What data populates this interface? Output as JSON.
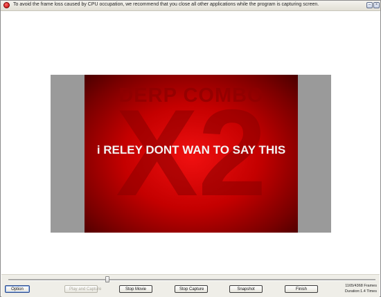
{
  "titlebar": {
    "message": "To avoid the frame loss caused by CPU occupation, we recommend that you close all other applications while the program is capturing screen.",
    "minimize_glyph": "–",
    "close_glyph": "×"
  },
  "preview": {
    "background_title": "DERP COMBO",
    "background_big": "X2",
    "caption": "i RELEY DONT WAN TO SAY THIS"
  },
  "timeline": {
    "position_fraction": 0.27
  },
  "buttons": {
    "option": "Option",
    "play_and_capture": "Play and Capture",
    "stop_movie": "Stop Movie",
    "stop_capture": "Stop Capture",
    "snapshot": "Snapshot",
    "finish": "Finish"
  },
  "status": {
    "frames": "1165/4368 Frames",
    "duration": "Duration:1.4 Times"
  },
  "colors": {
    "accent_red": "#c40000",
    "frame_gray": "#9a9a9a"
  }
}
